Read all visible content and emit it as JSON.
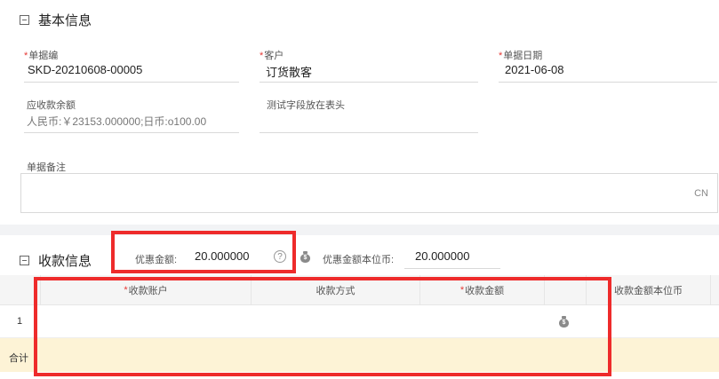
{
  "basic": {
    "title": "基本信息",
    "doc_no": {
      "label": "单据编",
      "value": "SKD-20210608-00005"
    },
    "customer": {
      "label": "客户",
      "value": "订货散客"
    },
    "doc_date": {
      "label": "单据日期",
      "value": "2021-06-08"
    },
    "receivable": {
      "label": "应收款余额",
      "value": "人民币:￥23153.000000;日币:o100.00"
    },
    "test_field": {
      "label": "测试字段放在表头"
    },
    "remark": {
      "label": "单据备注",
      "lang": "CN"
    }
  },
  "payment": {
    "title": "收款信息",
    "discount": {
      "label": "优惠金额:",
      "value": "20.000000",
      "help": "?"
    },
    "discount_base": {
      "label": "优惠金额本位币:",
      "value": "20.000000"
    },
    "table": {
      "columns": [
        "收款账户",
        "收款方式",
        "收款金额",
        "收款金额本位币"
      ],
      "rows": [
        {
          "index": "1"
        }
      ],
      "total_label": "合计"
    }
  },
  "colors": {
    "highlight": "#ee2b2b",
    "required": "#e53935",
    "totals_bg": "#fdf3d6"
  }
}
